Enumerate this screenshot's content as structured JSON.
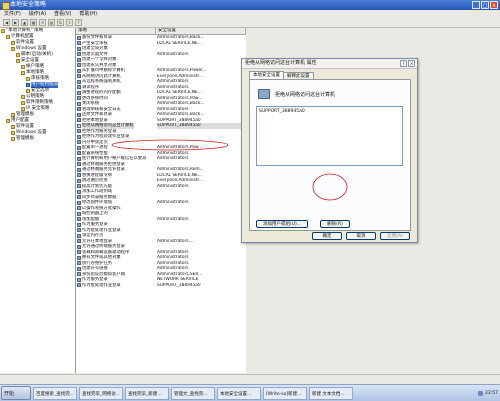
{
  "window": {
    "title": "本地安全策略"
  },
  "menubar": [
    "文件(F)",
    "操作(A)",
    "查看(V)",
    "帮助(H)"
  ],
  "tree": [
    {
      "label": "\"本地计算机\" 策略",
      "indent": 0
    },
    {
      "label": "计算机配置",
      "indent": 1
    },
    {
      "label": "软件设置",
      "indent": 2
    },
    {
      "label": "Windows 设置",
      "indent": 2
    },
    {
      "label": "脚本(启动/关机)",
      "indent": 3
    },
    {
      "label": "安全设置",
      "indent": 3
    },
    {
      "label": "帐户策略",
      "indent": 4
    },
    {
      "label": "本地策略",
      "indent": 4
    },
    {
      "label": "审核策略",
      "indent": 5
    },
    {
      "label": "用户权利指派",
      "indent": 5,
      "selected": true
    },
    {
      "label": "安全选项",
      "indent": 5
    },
    {
      "label": "公钥策略",
      "indent": 4
    },
    {
      "label": "软件限制策略",
      "indent": 4
    },
    {
      "label": "IP 安全策略",
      "indent": 4
    },
    {
      "label": "管理模板",
      "indent": 2
    },
    {
      "label": "用户配置",
      "indent": 1
    },
    {
      "label": "软件设置",
      "indent": 2
    },
    {
      "label": "Windows 设置",
      "indent": 2
    },
    {
      "label": "管理模板",
      "indent": 2
    }
  ],
  "columns": {
    "policy": "策略",
    "setting": "安全设置"
  },
  "rows": [
    {
      "policy": "备份文件和目录",
      "setting": "Administrators,Back..."
    },
    {
      "policy": "产生安全审核",
      "setting": "LOCAL SERVICE,NE..."
    },
    {
      "policy": "创建全局对象",
      "setting": ""
    },
    {
      "policy": "创建页面文件",
      "setting": "Administrators"
    },
    {
      "policy": "创建一个令牌对象",
      "setting": ""
    },
    {
      "policy": "创建永久共享对象",
      "setting": ""
    },
    {
      "policy": "从扩展坞中删除计算机",
      "setting": "Administrators,Power..."
    },
    {
      "policy": "从网络访问此计算机",
      "setting": "Everyone,Administr..."
    },
    {
      "policy": "从远程系统强制关机",
      "setting": "Administrators"
    },
    {
      "policy": "调试程序",
      "setting": "Administrators"
    },
    {
      "policy": "调整进程的内存配额",
      "setting": "LOCAL SERVICE,NE..."
    },
    {
      "policy": "更改系统时间",
      "setting": "Administrators,Pow..."
    },
    {
      "policy": "关闭系统",
      "setting": "Administrators,Back..."
    },
    {
      "policy": "管理审核和安全日志",
      "setting": "Administrators"
    },
    {
      "policy": "还原文件和目录",
      "setting": "Administrators,Back..."
    },
    {
      "policy": "拒绝本地登录",
      "setting": "SUPPORT_388945a0"
    },
    {
      "policy": "拒绝从网络访问这台计算机",
      "setting": "SUPPORT_388945a0",
      "selected": true
    },
    {
      "policy": "拒绝作为服务登录",
      "setting": ""
    },
    {
      "policy": "拒绝作为批处理作业登录",
      "setting": ""
    },
    {
      "policy": "内存中锁定页",
      "setting": ""
    },
    {
      "policy": "配置单一进程",
      "setting": "Administrators,Pow..."
    },
    {
      "policy": "配置系统性能",
      "setting": "Administrators"
    },
    {
      "policy": "使计算机和用户帐户被信任以委派",
      "setting": "Administrators"
    },
    {
      "policy": "通过终端服务拒绝登录",
      "setting": ""
    },
    {
      "policy": "通过终端服务允许登录",
      "setting": "Administrators,Rem..."
    },
    {
      "policy": "替换进程级令牌",
      "setting": "LOCAL SERVICE,NE..."
    },
    {
      "policy": "跳过遍历检查",
      "setting": "Everyone,Administr..."
    },
    {
      "policy": "提高计划优先级",
      "setting": "Administrators"
    },
    {
      "policy": "添加工作站到域",
      "setting": ""
    },
    {
      "policy": "同步目录服务数据",
      "setting": ""
    },
    {
      "policy": "修改固件环境值",
      "setting": "Administrators"
    },
    {
      "policy": "以操作系统方式操作",
      "setting": ""
    },
    {
      "policy": "域控制器上的",
      "setting": ""
    },
    {
      "policy": "增加配额",
      "setting": "Administrators"
    },
    {
      "policy": "作为服务登录",
      "setting": ""
    },
    {
      "policy": "作为批处理作业登录",
      "setting": ""
    },
    {
      "policy": "锁定内存页",
      "setting": ""
    },
    {
      "policy": "允许在本地登录",
      "setting": "Administrators,..."
    },
    {
      "policy": "允许通过终端服务登录",
      "setting": ""
    },
    {
      "policy": "装载和卸载设备驱动程序",
      "setting": "Administrators"
    },
    {
      "policy": "拥有文件或其他对象",
      "setting": "Administrators"
    },
    {
      "policy": "执行卷维护任务",
      "setting": "Administrators"
    },
    {
      "policy": "创建符号链接",
      "setting": "Administrators"
    },
    {
      "policy": "身份验证后模拟客户端",
      "setting": "Administrators,SER..."
    },
    {
      "policy": "作为服务登录",
      "setting": "NETWORK SERVICE"
    },
    {
      "policy": "作为批处理作业登录",
      "setting": "SUPPORT_388945a0"
    }
  ],
  "dialog": {
    "title": "拒绝从网络访问这台计算机 属性",
    "tabs": [
      "本地安全设置",
      "解释此设置"
    ],
    "policy_label": "拒绝从网络访问这台计算机",
    "list_items": [
      "SUPPORT_388945a0"
    ],
    "add_button": "添加用户或组(U)...",
    "remove_button": "删除(R)",
    "ok_button": "确定",
    "cancel_button": "取消",
    "apply_button": "应用(A)"
  },
  "taskbar": {
    "start_label": "开始",
    "tasks": [
      "百度搜索_查找完...",
      "查找完毕_网络访...",
      "查找完毕_新建...",
      "管理文_查找完...",
      "本地安全设置...",
      "[Write-so]新建...",
      "新建 文本文档..."
    ],
    "clock": "23:57"
  }
}
